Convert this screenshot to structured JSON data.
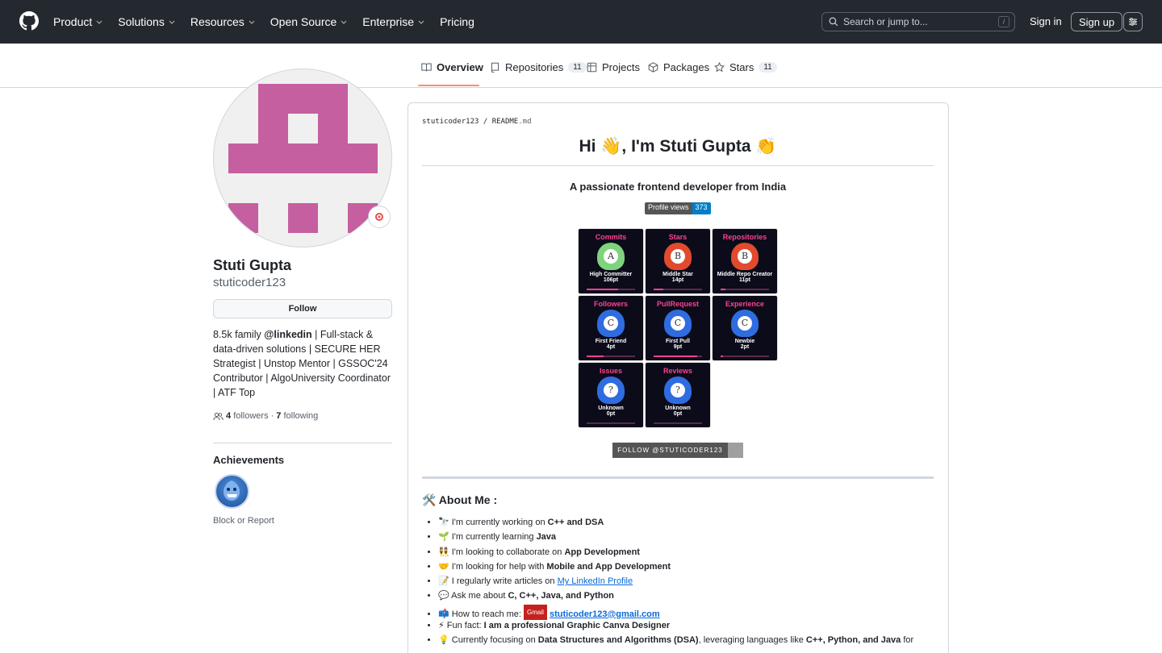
{
  "header": {
    "nav": [
      "Product",
      "Solutions",
      "Resources",
      "Open Source",
      "Enterprise",
      "Pricing"
    ],
    "search_placeholder": "Search or jump to...",
    "search_shortcut": "/",
    "signin": "Sign in",
    "signup": "Sign up"
  },
  "tabs": {
    "overview": "Overview",
    "repositories": "Repositories",
    "repositories_count": "11",
    "projects": "Projects",
    "packages": "Packages",
    "stars": "Stars",
    "stars_count": "11"
  },
  "profile": {
    "fullname": "Stuti Gupta",
    "username": "stuticoder123",
    "follow": "Follow",
    "bio_prefix": "8.5k family ",
    "bio_handle": "@linkedin",
    "bio_rest": " | Full-stack & data-driven solutions | SECURE HER Strategist | Unstop Mentor | GSSOC'24 Contributor | AlgoUniversity Coordinator | ATF Top",
    "followers_count": "4",
    "followers_label": "followers",
    "dot": "·",
    "following_count": "7",
    "following_label": "following",
    "achievements_title": "Achievements",
    "block_report": "Block or Report"
  },
  "readme": {
    "path_user": "stuticoder123",
    "path_sep": "/",
    "path_file": "README",
    "path_ext": ".md",
    "title": "Hi 👋, I'm Stuti Gupta 👏",
    "subtitle": "A passionate frontend developer from India",
    "views_label": "Profile views",
    "views_count": "373",
    "follow_badge": "FOLLOW @STUTICODER123",
    "about_title": "🛠️ About Me :",
    "gmail_badge": "Gmail",
    "about": [
      {
        "pre": "🔭 I'm currently working on ",
        "bold": "C++ and DSA"
      },
      {
        "pre": "🌱 I'm currently learning ",
        "bold": "Java"
      },
      {
        "pre": "👯 I'm looking to collaborate on ",
        "bold": "App Development"
      },
      {
        "pre": "🤝 I'm looking for help with ",
        "bold": "Mobile and App Development"
      },
      {
        "pre": "📝 I regularly write articles on ",
        "link": "My LinkedIn Profile"
      },
      {
        "pre": "💬 Ask me about ",
        "bold": "C, C++, Java, and Python"
      },
      {
        "pre": "📫 How to reach me: ",
        "mail": "stuticoder123@gmail.com"
      },
      {
        "pre": "⚡ Fun fact: ",
        "bold": "I am a professional Graphic Canva Designer"
      },
      {
        "pre": "💡 Currently focusing on ",
        "bold": "Data Structures and Algorithms (DSA)",
        "post": ", leveraging languages like ",
        "bold2": "C++, Python, and Java",
        "post2": " for"
      }
    ]
  },
  "trophies": [
    {
      "title": "Commits",
      "rank": "A",
      "name": "High Committer",
      "points": "106pt",
      "progress": 0.65,
      "color": "#7ed37e"
    },
    {
      "title": "Stars",
      "rank": "B",
      "name": "Middle Star",
      "points": "14pt",
      "progress": 0.2,
      "color": "#e24a2e"
    },
    {
      "title": "Repositories",
      "rank": "B",
      "name": "Middle Repo Creator",
      "points": "11pt",
      "progress": 0.1,
      "color": "#e24a2e"
    },
    {
      "title": "Followers",
      "rank": "C",
      "name": "First Friend",
      "points": "4pt",
      "progress": 0.35,
      "color": "#2f6ce0"
    },
    {
      "title": "PullRequest",
      "rank": "C",
      "name": "First Pull",
      "points": "9pt",
      "progress": 0.9,
      "color": "#2f6ce0"
    },
    {
      "title": "Experience",
      "rank": "C",
      "name": "Newbie",
      "points": "2pt",
      "progress": 0.05,
      "color": "#2f6ce0"
    },
    {
      "title": "Issues",
      "rank": "?",
      "name": "Unknown",
      "points": "0pt",
      "progress": 0,
      "color": "#2f6ce0"
    },
    {
      "title": "Reviews",
      "rank": "?",
      "name": "Unknown",
      "points": "0pt",
      "progress": 0,
      "color": "#2f6ce0"
    }
  ]
}
